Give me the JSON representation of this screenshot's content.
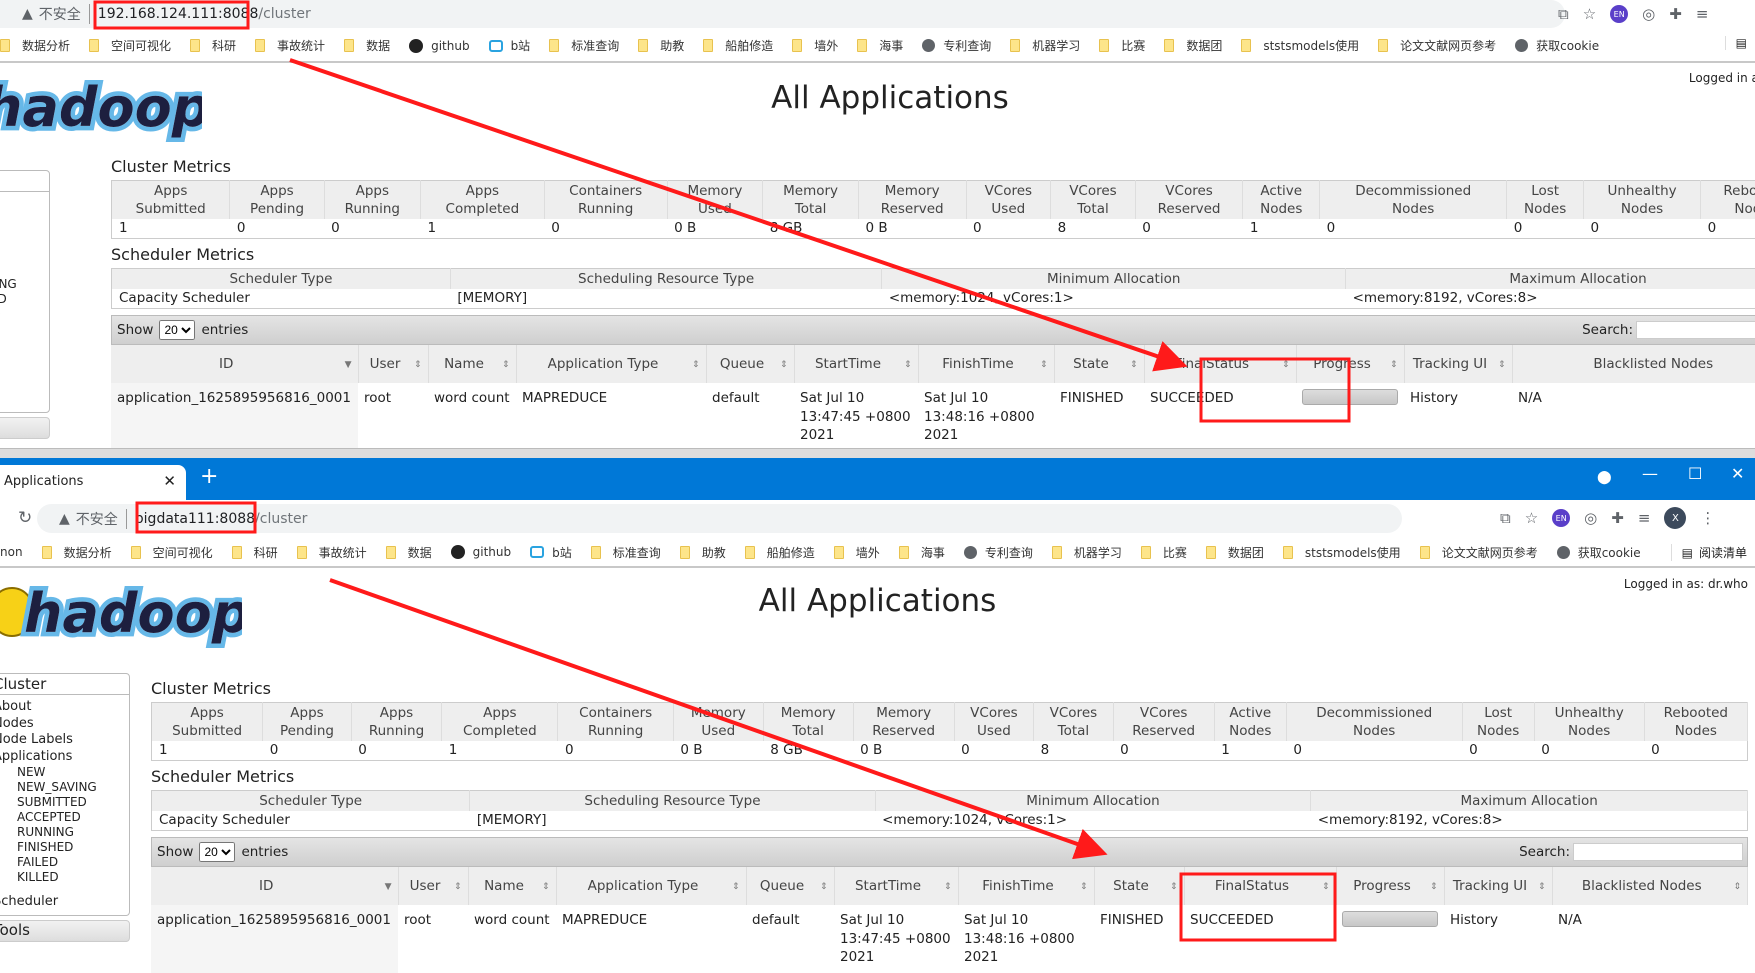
{
  "windows": {
    "top": {
      "url_host": "192.168.124.111:8088",
      "url_path": "/cluster",
      "insecure_label": "不安全"
    },
    "bottom": {
      "tab_title": "Applications",
      "url_host": "bigdata111:8088",
      "url_path": "/cluster",
      "insecure_label": "不安全",
      "profile_initial": "X",
      "reading_list": "阅读清单",
      "clipped_bookmark": "non"
    }
  },
  "bookmarks": [
    {
      "label": "数据分析",
      "icon": "folder"
    },
    {
      "label": "空间可视化",
      "icon": "folder"
    },
    {
      "label": "科研",
      "icon": "folder"
    },
    {
      "label": "事故统计",
      "icon": "folder"
    },
    {
      "label": "数据",
      "icon": "folder"
    },
    {
      "label": "github",
      "icon": "github"
    },
    {
      "label": "b站",
      "icon": "bilibili"
    },
    {
      "label": "标准查询",
      "icon": "folder"
    },
    {
      "label": "助教",
      "icon": "folder"
    },
    {
      "label": "船舶修造",
      "icon": "folder"
    },
    {
      "label": "墙外",
      "icon": "folder"
    },
    {
      "label": "海事",
      "icon": "folder"
    },
    {
      "label": "专利查询",
      "icon": "globe"
    },
    {
      "label": "机器学习",
      "icon": "folder"
    },
    {
      "label": "比赛",
      "icon": "folder"
    },
    {
      "label": "数据团",
      "icon": "folder"
    },
    {
      "label": "ststsmodels使用",
      "icon": "folder"
    },
    {
      "label": "论文文献网页参考",
      "icon": "folder"
    },
    {
      "label": "获取cookie",
      "icon": "globe"
    }
  ],
  "page": {
    "logo_text": "hadoop",
    "title": "All Applications",
    "logged_in": "Logged in as: dr.who",
    "sidebar": {
      "header": "Cluster",
      "items": [
        "About",
        "Nodes",
        "Node Labels",
        "Applications"
      ],
      "sub_items": [
        "NEW",
        "NEW_SAVING",
        "SUBMITTED",
        "ACCEPTED",
        "RUNNING",
        "FINISHED",
        "FAILED",
        "KILLED"
      ],
      "scheduler": "Scheduler",
      "tools": "Tools"
    },
    "cluster_metrics": {
      "heading": "Cluster Metrics",
      "headers": [
        [
          "Apps",
          "Submitted"
        ],
        [
          "Apps",
          "Pending"
        ],
        [
          "Apps",
          "Running"
        ],
        [
          "Apps",
          "Completed"
        ],
        [
          "Containers",
          "Running"
        ],
        [
          "Memory",
          "Used"
        ],
        [
          "Memory",
          "Total"
        ],
        [
          "Memory",
          "Reserved"
        ],
        [
          "VCores",
          "Used"
        ],
        [
          "VCores",
          "Total"
        ],
        [
          "VCores",
          "Reserved"
        ],
        [
          "Active",
          "Nodes"
        ],
        [
          "Decommissioned",
          "Nodes"
        ],
        [
          "Lost",
          "Nodes"
        ],
        [
          "Unhealthy",
          "Nodes"
        ],
        [
          "Rebooted",
          "Nodes"
        ]
      ],
      "values": [
        "1",
        "0",
        "0",
        "1",
        "0",
        "0 B",
        "8 GB",
        "0 B",
        "0",
        "8",
        "0",
        "1",
        "0",
        "0",
        "0",
        "0"
      ]
    },
    "scheduler_metrics": {
      "heading": "Scheduler Metrics",
      "headers": [
        "Scheduler Type",
        "Scheduling Resource Type",
        "Minimum Allocation",
        "Maximum Allocation"
      ],
      "values": [
        "Capacity Scheduler",
        "[MEMORY]",
        "<memory:1024, vCores:1>",
        "<memory:8192, vCores:8>"
      ]
    },
    "table_controls": {
      "show": "Show",
      "entries_value": "20",
      "entries": "entries",
      "search": "Search:"
    },
    "apps_table": {
      "headers": [
        "ID",
        "User",
        "Name",
        "Application Type",
        "Queue",
        "StartTime",
        "FinishTime",
        "State",
        "FinalStatus",
        "Progress",
        "Tracking UI",
        "Blacklisted Nodes"
      ],
      "rows": [
        {
          "id": "application_1625895956816_0001",
          "user": "root",
          "name": "word count",
          "type": "MAPREDUCE",
          "queue": "default",
          "start": "Sat Jul 10 13:47:45 +0800 2021",
          "finish": "Sat Jul 10 13:48:16 +0800 2021",
          "state": "FINISHED",
          "final_status": "SUCCEEDED",
          "progress": 1.0,
          "tracking": "History",
          "blacklisted": "N/A"
        }
      ]
    }
  },
  "annotation_color": "#ff1a1a"
}
